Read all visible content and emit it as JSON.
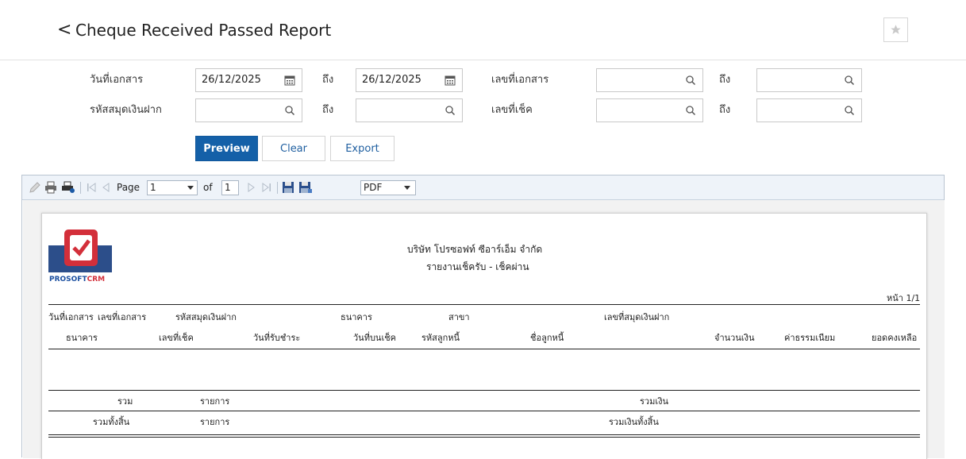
{
  "page": {
    "back_symbol": "<",
    "title": "Cheque Received Passed Report"
  },
  "filters": {
    "doc_date_label": "วันที่เอกสาร",
    "doc_date_from": "26/12/2025",
    "to_label": "ถึง",
    "doc_date_to": "26/12/2025",
    "doc_no_label": "เลขที่เอกสาร",
    "doc_no_from": "",
    "doc_no_to": "",
    "bankbook_label": "รหัสสมุดเงินฝาก",
    "bankbook_from": "",
    "bankbook_to": "",
    "cheque_no_label": "เลขที่เช็ค",
    "cheque_no_from": "",
    "cheque_no_to": ""
  },
  "buttons": {
    "preview": "Preview",
    "clear": "Clear",
    "export": "Export"
  },
  "toolbar": {
    "page_label": "Page",
    "page_value": "1",
    "of_label": "of",
    "total_pages": "1",
    "format": "PDF"
  },
  "report": {
    "logo_text_blue": "PROSOFT",
    "logo_text_red": "CRM",
    "company_name": "บริษัท โปรซอฟท์ ซีอาร์เอ็ม จำกัด",
    "report_title": "รายงานเช็ครับ - เช็คผ่าน",
    "page_indicator": "หน้า 1/1",
    "header_row1": {
      "doc_date": "วันที่เอกสาร",
      "doc_no": "เลขที่เอกสาร",
      "bankbook_code": "รหัสสมุดเงินฝาก",
      "bank": "ธนาคาร",
      "branch": "สาขา",
      "bankbook_no": "เลขที่สมุดเงินฝาก"
    },
    "header_row2": {
      "bank": "ธนาคาร",
      "cheque_no": "เลขที่เช็ค",
      "receive_date": "วันที่รับชำระ",
      "cheque_date": "วันที่บนเช็ค",
      "debtor_code": "รหัสลูกหนี้",
      "debtor_name": "ชื่อลูกหนี้",
      "amount": "จำนวนเงิน",
      "fee": "ค่าธรรมเนียม",
      "balance": "ยอดคงเหลือ"
    },
    "summary": {
      "total_label": "รวม",
      "items_label": "รายการ",
      "total_amount_label": "รวมเงิน",
      "grand_total_label": "รวมทั้งสิ้น",
      "grand_items_label": "รายการ",
      "grand_total_amount_label": "รวมเงินทั้งสิ้น"
    }
  },
  "colors": {
    "primary": "#1460a8",
    "link": "#1f5fa0",
    "logo_red": "#d32f3a",
    "logo_blue": "#1b4fa0"
  },
  "icons": [
    "back-chevron-icon",
    "star-icon",
    "calendar-icon",
    "search-icon",
    "print-icon",
    "first-page-icon",
    "prev-page-icon",
    "next-page-icon",
    "last-page-icon",
    "save-icon",
    "dropdown-arrow-icon"
  ]
}
